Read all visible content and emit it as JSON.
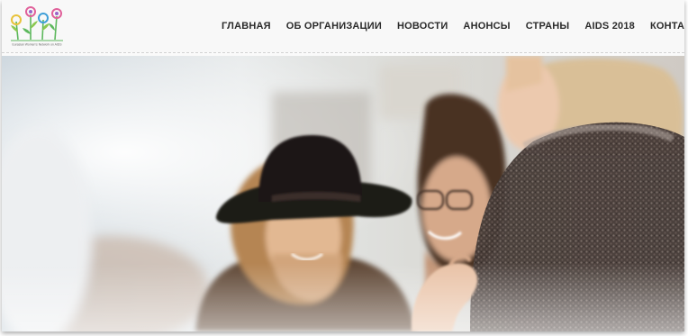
{
  "header": {
    "logo_text": "Eurasian Women's Network on AIDS",
    "nav": [
      {
        "label": "ГЛАВНАЯ"
      },
      {
        "label": "ОБ ОРГАНИЗАЦИИ"
      },
      {
        "label": "НОВОСТИ"
      },
      {
        "label": "АНОНСЫ"
      },
      {
        "label": "СТРАНЫ"
      },
      {
        "label": "AIDS 2018"
      },
      {
        "label": "КОНТАКТЫ"
      }
    ]
  },
  "colors": {
    "logo_pink": "#e0609a",
    "logo_purple": "#9a63c8",
    "logo_blue": "#3e9fd8",
    "logo_yellow": "#e8c23a",
    "logo_green": "#5cb85c",
    "nav_text": "#2a2a2a"
  },
  "hero": {
    "image": "photo of smiling women"
  }
}
